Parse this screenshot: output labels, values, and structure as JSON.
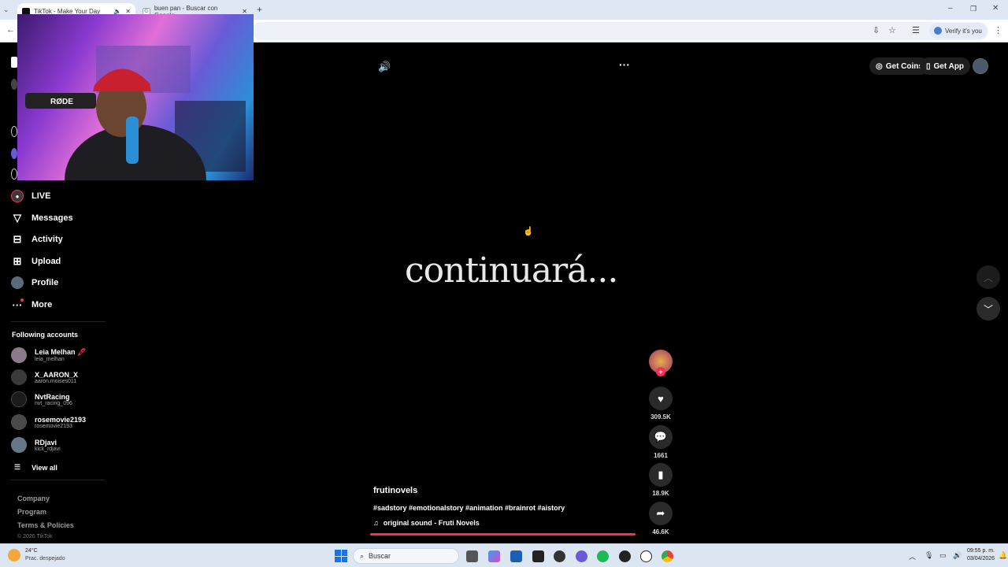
{
  "browser": {
    "tabs": [
      {
        "title": "TikTok - Make Your Day",
        "active": true
      },
      {
        "title": "buen pan - Buscar con Google",
        "active": false
      }
    ],
    "verify_label": "Verify it's you"
  },
  "sidebar": {
    "nav": [
      {
        "label": "LIVE",
        "icon": "live-icon"
      },
      {
        "label": "Messages",
        "icon": "messages-icon"
      },
      {
        "label": "Activity",
        "icon": "activity-icon"
      },
      {
        "label": "Upload",
        "icon": "upload-icon"
      },
      {
        "label": "Profile",
        "icon": "profile-icon"
      },
      {
        "label": "More",
        "icon": "more-icon"
      }
    ],
    "following_title": "Following accounts",
    "accounts": [
      {
        "name": "Leia Melhan",
        "handle": "leia_melhan"
      },
      {
        "name": "X_AARON_X",
        "handle": "aaron.moises011"
      },
      {
        "name": "NvtRacing",
        "handle": "nvt_racing_096"
      },
      {
        "name": "rosemovie2193",
        "handle": "rosemovie2193"
      },
      {
        "name": "RDjavi",
        "handle": "kick_rdjavi"
      }
    ],
    "view_all": "View all",
    "footer": [
      "Company",
      "Program",
      "Terms & Policies"
    ],
    "copyright": "© 2026 TikTok"
  },
  "header": {
    "get_coins": "Get Coins",
    "get_app": "Get App"
  },
  "video": {
    "caption": "continuará...",
    "author": "frutinovels",
    "hashtags": "#sadstory #emotionalstory #animation #brainrot #aistory",
    "sound": "original sound - Fruti Novels",
    "likes": "309.5K",
    "comments": "1661",
    "saves": "18.9K",
    "shares": "46.6K",
    "progress": 0.99
  },
  "taskbar": {
    "weather_temp": "24°C",
    "weather_desc": "Prac. despejado",
    "search": "Buscar",
    "time": "09:55 p. m.",
    "date": "03/04/2026"
  },
  "colors": {
    "accent": "#fe2c55",
    "background": "#000000"
  }
}
